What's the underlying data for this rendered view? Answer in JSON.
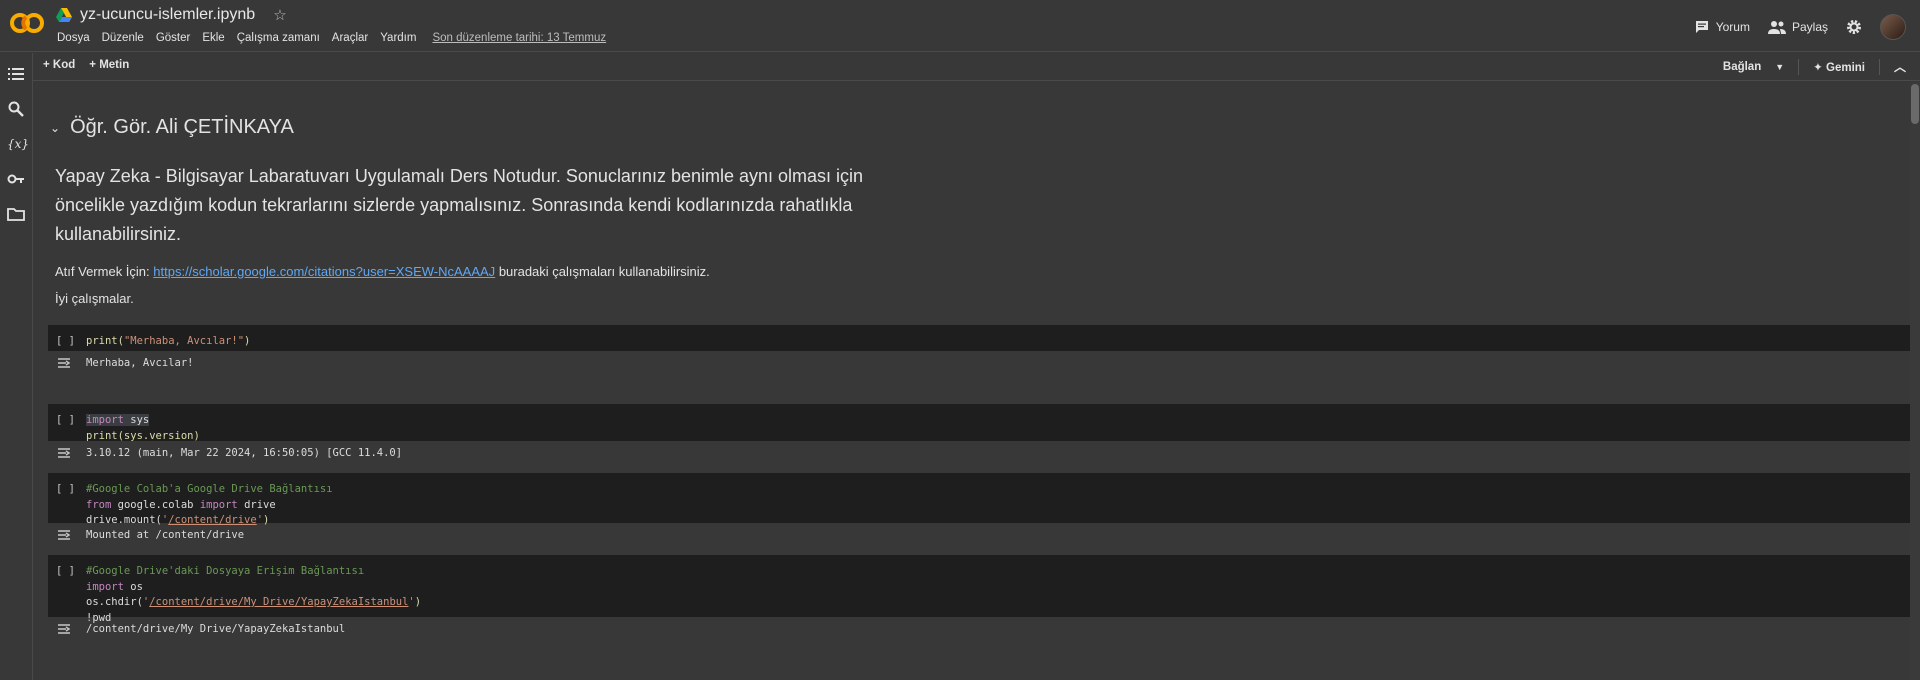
{
  "header": {
    "title": "yz-ucuncu-islemler.ipynb",
    "menu": [
      "Dosya",
      "Düzenle",
      "Göster",
      "Ekle",
      "Çalışma zamanı",
      "Araçlar",
      "Yardım"
    ],
    "last_edit": "Son düzenleme tarihi: 13 Temmuz",
    "comment": "Yorum",
    "share": "Paylaş"
  },
  "toolbar": {
    "add_code": "Kod",
    "add_text": "Metin",
    "connect": "Bağlan",
    "gemini": "Gemini"
  },
  "sidebar": {
    "items": [
      "toc-icon",
      "search-icon",
      "variables-icon",
      "secrets-key-icon",
      "files-folder-icon"
    ]
  },
  "notebook": {
    "section_title": "Öğr. Gör. Ali ÇETİNKAYA",
    "intro": "Yapay Zeka - Bilgisayar Labaratuvarı Uygulamalı Ders Notudur. Sonuclarınız benimle aynı olması için öncelikle yazdığım kodun tekrarlarını sizlerde yapmalısınız. Sonrasında kendi kodlarınızda rahatlıkla kullanabilirsiniz.",
    "cite_prefix": "Atıf Vermek İçin:",
    "cite_link": "https://scholar.google.com/citations?user=XSEW-NcAAAAJ",
    "cite_suffix": "buradaki çalışmaları kullanabilirsiniz.",
    "goodbye": "İyi çalışmalar.",
    "run_marker": "[ ]",
    "cells": [
      {
        "c1": {
          "fn": "print",
          "open": "(",
          "str": "\"Merhaba, Avcılar!\"",
          "close": ")"
        },
        "output": "Merhaba, Avcılar!"
      },
      {
        "c2": {
          "kw": "import",
          "mod": " sys",
          "fn": "print",
          "rest": "(sys.version)"
        },
        "output": "3.10.12 (main, Mar 22 2024, 16:50:05) [GCC 11.4.0]"
      },
      {
        "c3": {
          "comment": "#Google Colab'a Google Drive Bağlantısı",
          "from": "from",
          "mod": " google.colab ",
          "imp": "import",
          "name": " drive",
          "call": "drive.mount(",
          "q1": "'",
          "path": "/content/drive",
          "q2": "'",
          "end": ")"
        },
        "output": "Mounted at /content/drive"
      },
      {
        "c4": {
          "comment": "#Google Drive'daki Dosyaya Erişim Bağlantısı",
          "imp": "import",
          "mod": " os",
          "call": "os.chdir(",
          "q1": "'",
          "path": "/content/drive/My Drive/YapayZekaIstanbul",
          "q2": "'",
          "end": ")",
          "shell": "!pwd"
        },
        "output": "/content/drive/My Drive/YapayZekaIstanbul"
      }
    ]
  },
  "colors": {
    "background": "#383838",
    "code_bg": "#1e1e1e",
    "link": "#5fa8f5",
    "keyword": "#c586c0",
    "string": "#ce9178",
    "comment": "#6a9955",
    "function": "#dcdcaa"
  }
}
